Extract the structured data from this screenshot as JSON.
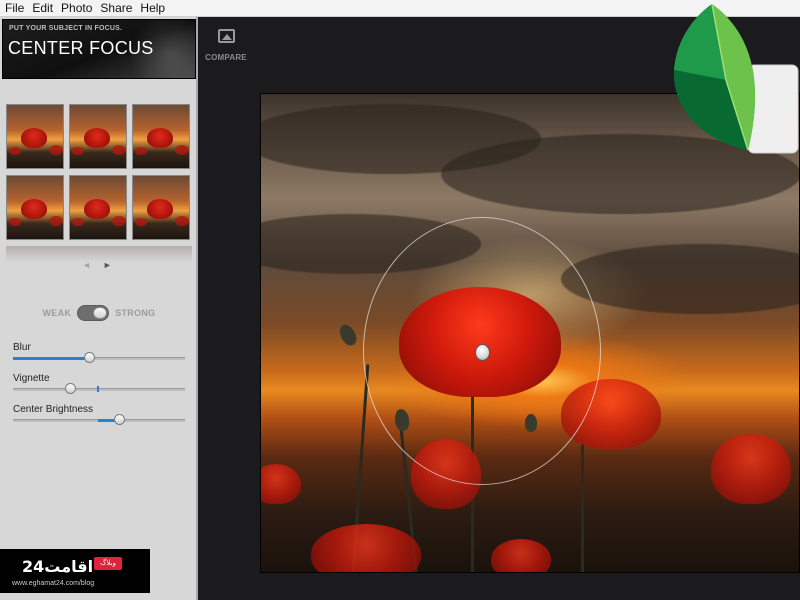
{
  "menu": {
    "items": [
      "File",
      "Edit",
      "Photo",
      "Share",
      "Help"
    ]
  },
  "panel": {
    "subtitle": "PUT YOUR SUBJECT IN FOCUS.",
    "title": "CENTER FOCUS",
    "preset_count": 6,
    "pager": {
      "prev": "◄",
      "next": "►"
    },
    "toggle": {
      "weak": "WEAK",
      "strong": "STRONG",
      "state": "strong"
    },
    "sliders": [
      {
        "label": "Blur",
        "value": 0.45,
        "fill_color": "#2d7fd1"
      },
      {
        "label": "Vignette",
        "value": 0.34,
        "fill_color": "#2d7fd1"
      },
      {
        "label": "Center Brightness",
        "value": 0.62,
        "fill_color": "#2d7fd1"
      }
    ]
  },
  "canvas": {
    "compare_label": "COMPARE",
    "compare_icon": "image-icon"
  },
  "watermark": {
    "logo_text": "اقامت24",
    "badge": "وبلاگ",
    "url": "www.eghamat24.com/blog"
  },
  "colors": {
    "accent": "#2d7fd1",
    "logo_dark_green": "#0c7a3a",
    "logo_light_green": "#6cc24a"
  }
}
